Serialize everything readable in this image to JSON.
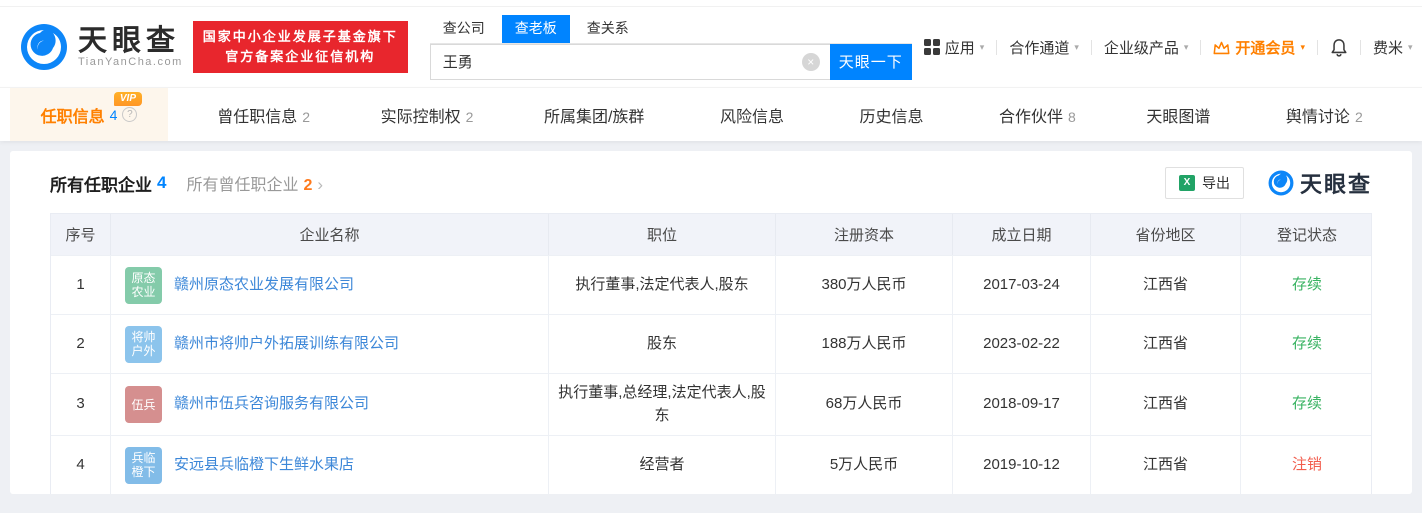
{
  "brand": {
    "name": "天眼查",
    "domain": "TianYanCha.com",
    "blue": "#0084ff",
    "orange": "#ff8000"
  },
  "header": {
    "badge": {
      "line1": "国家中小企业发展子基金旗下",
      "line2": "官方备案企业征信机构",
      "bg": "#e8262d"
    },
    "search": {
      "tabs": [
        {
          "label": "查公司",
          "active": false
        },
        {
          "label": "查老板",
          "active": true
        },
        {
          "label": "查关系",
          "active": false
        }
      ],
      "value": "王勇",
      "clear_icon": "×",
      "button": "天眼一下"
    },
    "nav": {
      "apps": "应用",
      "cooperation": "合作通道",
      "enterprise": "企业级产品",
      "member": "开通会员",
      "user": "费米",
      "caret": "▾"
    }
  },
  "tabs": [
    {
      "label": "任职信息",
      "count": "4",
      "active": true,
      "vip": "VIP",
      "help": "?"
    },
    {
      "label": "曾任职信息",
      "count": "2"
    },
    {
      "label": "实际控制权",
      "count": "2"
    },
    {
      "label": "所属集团/族群",
      "count": ""
    },
    {
      "label": "风险信息",
      "count": ""
    },
    {
      "label": "历史信息",
      "count": ""
    },
    {
      "label": "合作伙伴",
      "count": "8"
    },
    {
      "label": "天眼图谱",
      "count": ""
    },
    {
      "label": "舆情讨论",
      "count": "2"
    }
  ],
  "section": {
    "title": "所有任职企业",
    "title_count": "4",
    "secondary": "所有曾任职企业",
    "secondary_count": "2",
    "arrow": "›",
    "export_label": "导出",
    "excel_glyph": "X",
    "watermark": "天眼查"
  },
  "table": {
    "columns": [
      "序号",
      "企业名称",
      "职位",
      "注册资本",
      "成立日期",
      "省份地区",
      "登记状态"
    ],
    "rows": [
      {
        "no": "1",
        "icon_line1": "原态",
        "icon_line2": "农业",
        "icon_color": "#84cbaa",
        "company": "赣州原态农业发展有限公司",
        "position": "执行董事,法定代表人,股东",
        "capital": "380万人民币",
        "date": "2017-03-24",
        "region": "江西省",
        "status": "存续",
        "status_color": "#39b362"
      },
      {
        "no": "2",
        "icon_line1": "将帅",
        "icon_line2": "户外",
        "icon_color": "#8cc4ec",
        "company": "赣州市将帅户外拓展训练有限公司",
        "position": "股东",
        "capital": "188万人民币",
        "date": "2023-02-22",
        "region": "江西省",
        "status": "存续",
        "status_color": "#39b362"
      },
      {
        "no": "3",
        "icon_line1": "伍兵",
        "icon_line2": "",
        "icon_color": "#d58f8f",
        "company": "赣州市伍兵咨询服务有限公司",
        "position": "执行董事,总经理,法定代表人,股东",
        "capital": "68万人民币",
        "date": "2018-09-17",
        "region": "江西省",
        "status": "存续",
        "status_color": "#39b362"
      },
      {
        "no": "4",
        "icon_line1": "兵临",
        "icon_line2": "橙下",
        "icon_color": "#82bce8",
        "company": "安远县兵临橙下生鲜水果店",
        "position": "经营者",
        "capital": "5万人民币",
        "date": "2019-10-12",
        "region": "江西省",
        "status": "注销",
        "status_color": "#f25c4c"
      }
    ]
  }
}
